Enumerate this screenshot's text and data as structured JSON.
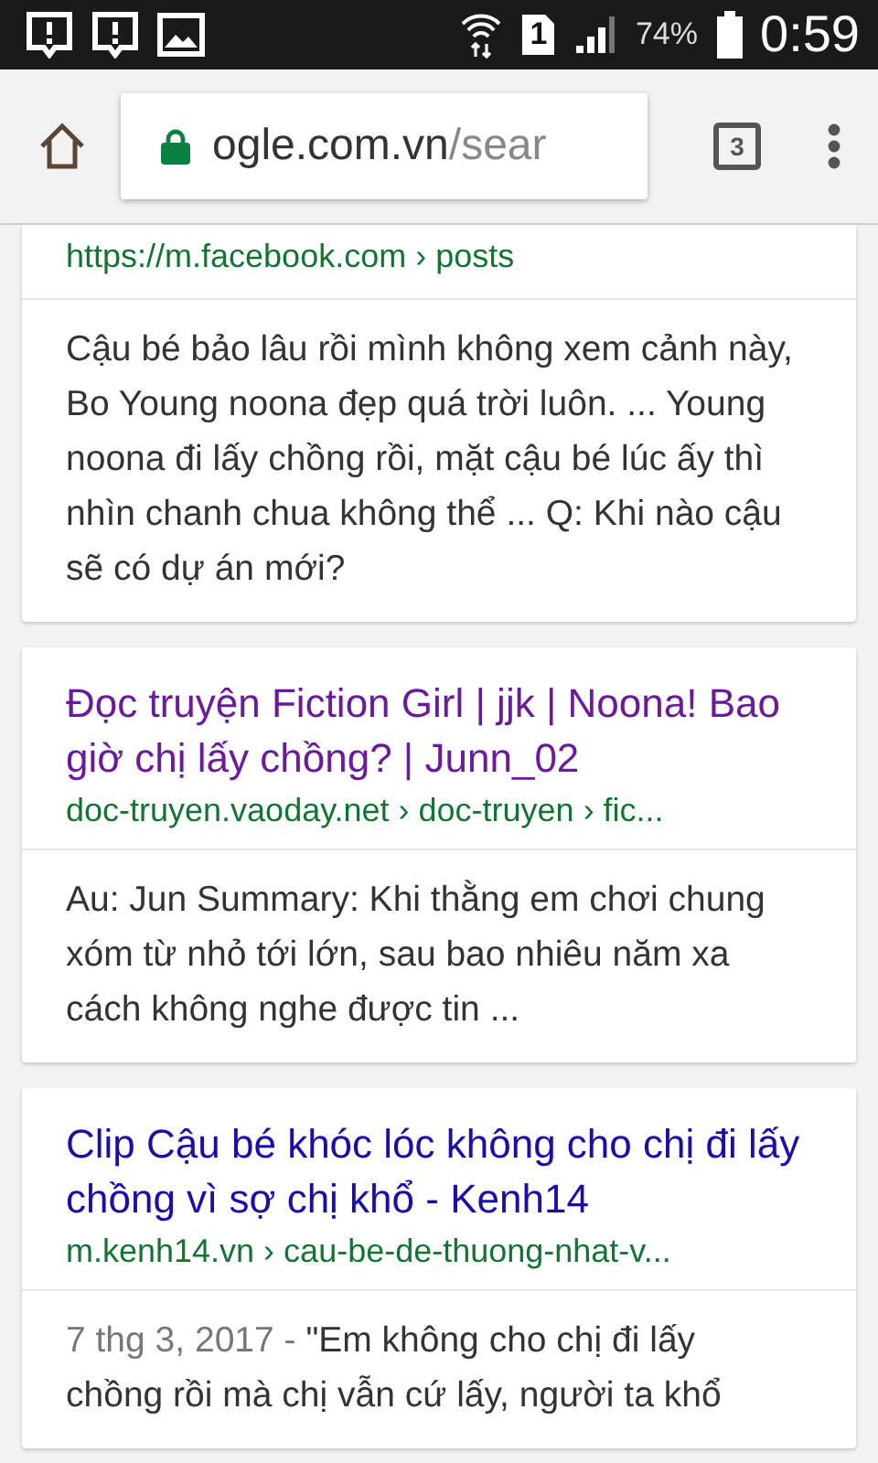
{
  "status_bar": {
    "sim": "1",
    "battery": "74%",
    "time": "0:59"
  },
  "toolbar": {
    "url_host": "ogle.com.vn",
    "url_path": "/sear",
    "tab_count": "3"
  },
  "results": [
    {
      "url": "https://m.facebook.com › posts",
      "snippet": "Cậu bé bảo lâu rồi mình không xem cảnh này, Bo Young noona đẹp quá trời luôn. ... Young noona đi lấy chồng rồi, mặt cậu bé lúc ấy thì nhìn chanh chua không thể ... Q: Khi nào cậu sẽ có dự án mới?"
    },
    {
      "title": "Đọc truyện Fiction Girl | jjk | Noona! Bao giờ chị lấy chồng? | Junn_02",
      "url": "doc-truyen.vaoday.net › doc-truyen › fic...",
      "snippet": "Au: Jun Summary: Khi thằng em chơi chung xóm từ nhỏ tới lớn, sau bao nhiêu năm xa cách không nghe được tin ...",
      "visited": true
    },
    {
      "title": "Clip Cậu bé khóc lóc không cho chị đi lấy chồng vì sợ chị khổ - Kenh14",
      "url": "m.kenh14.vn › cau-be-de-thuong-nhat-v...",
      "date": "7 thg 3, 2017 - ",
      "snippet": "\"Em không cho chị đi lấy chồng rồi mà chị vẫn cứ lấy, người ta khổ",
      "visited": false
    }
  ]
}
